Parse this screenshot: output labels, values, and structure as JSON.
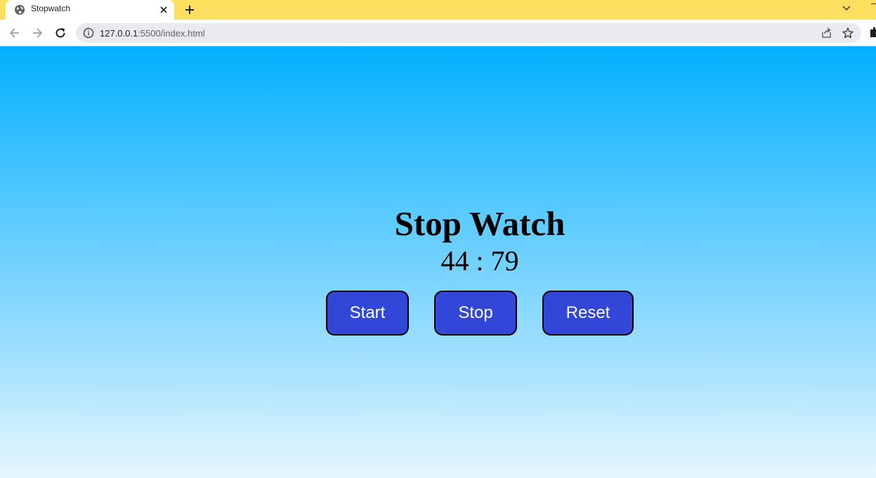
{
  "browser": {
    "tab": {
      "title": "Stopwatch",
      "favicon": "globe-icon"
    },
    "new_tab_label": "+",
    "address_bar": {
      "host": "127.0.0.1",
      "path": ":5500/index.html"
    },
    "colors": {
      "tabstrip": "#ffdf5f",
      "toolbar": "#ffffff",
      "omnibox": "#e8eaed"
    }
  },
  "page": {
    "title": "Stop Watch",
    "timer": "44 : 79",
    "buttons": {
      "start": "Start",
      "stop": "Stop",
      "reset": "Reset"
    },
    "colors": {
      "gradient_top": "#03b0fe",
      "gradient_bottom": "#e8f7fe",
      "button_bg": "#3247d8",
      "button_text": "#ffffff"
    }
  }
}
